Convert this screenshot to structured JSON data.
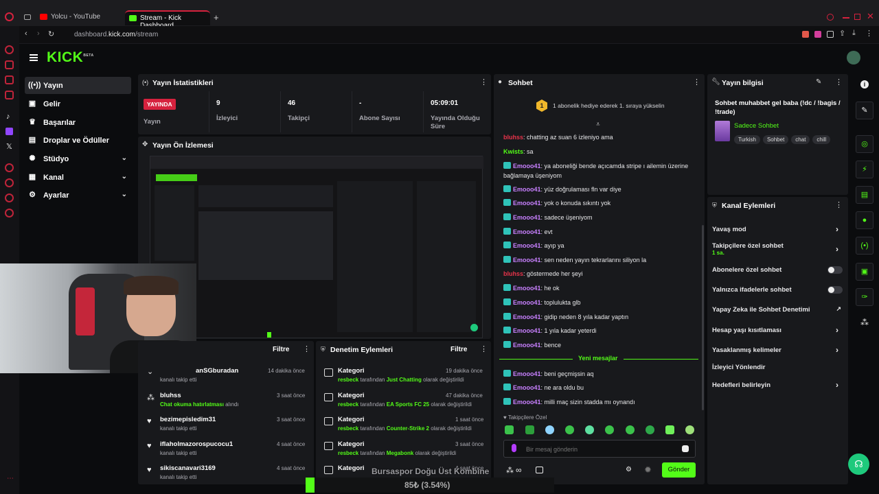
{
  "browser": {
    "tabs": [
      {
        "label": "Yolcu - YouTube"
      },
      {
        "label": "Stream - Kick Dashboard"
      }
    ],
    "new_tab": "+",
    "url_prefix": "dashboard.",
    "url_domain": "kick.com",
    "url_path": "/stream"
  },
  "nav": {
    "logo": "KICK",
    "logo_sup": "BETA",
    "items": [
      {
        "label": "Yayın",
        "icon": "broadcast-icon"
      },
      {
        "label": "Gelir",
        "icon": "wallet-icon"
      },
      {
        "label": "Başarılar",
        "icon": "trophy-icon"
      },
      {
        "label": "Droplar ve Ödüller",
        "icon": "gift-icon"
      },
      {
        "label": "Stüdyo",
        "icon": "palette-icon"
      },
      {
        "label": "Kanal",
        "icon": "channel-icon"
      },
      {
        "label": "Ayarlar",
        "icon": "gear-icon"
      }
    ]
  },
  "stats": {
    "title": "Yayın İstatistikleri",
    "live_badge": "YAYINDA",
    "live_label": "Yayın",
    "items": [
      {
        "value": "9",
        "label": "İzleyici"
      },
      {
        "value": "46",
        "label": "Takipçi"
      },
      {
        "value": "-",
        "label": "Abone Sayısı"
      },
      {
        "value": "05:09:01",
        "label": "Yayında Olduğu Süre"
      }
    ]
  },
  "preview": {
    "title": "Yayın Ön İzlemesi"
  },
  "events": {
    "filter": "Filtre",
    "rows": [
      {
        "user": "anSGburadan",
        "sub": "kanalı takip etti",
        "time": "14 dakika önce"
      },
      {
        "user": "bluhss",
        "sub_hl": "Chat okuma hatırlatması",
        "sub": " alındı",
        "time": "3 saat önce"
      },
      {
        "user": "bezimepisledim31",
        "sub": "kanalı takip etti",
        "time": "3 saat önce"
      },
      {
        "user": "iflaholmazorospucocu1",
        "sub": "kanalı takip etti",
        "time": "4 saat önce"
      },
      {
        "user": "sikiscanavari3169",
        "sub": "kanalı takip etti",
        "time": "4 saat önce"
      }
    ]
  },
  "audit": {
    "title": "Denetim Eylemleri",
    "filter": "Filtre",
    "rows": [
      {
        "title": "Kategori",
        "user": "resbeck",
        "mid": " tarafından ",
        "cat": "Just Chatting",
        "end": " olarak değiştirildi",
        "time": "19 dakika önce"
      },
      {
        "title": "Kategori",
        "user": "resbeck",
        "mid": " tarafından ",
        "cat": "EA Sports FC 25",
        "end": " olarak değiştirildi",
        "time": "47 dakika önce"
      },
      {
        "title": "Kategori",
        "user": "resbeck",
        "mid": " tarafından ",
        "cat": "Counter-Strike 2",
        "end": " olarak değiştirildi",
        "time": "1 saat önce"
      },
      {
        "title": "Kategori",
        "user": "resbeck",
        "mid": " tarafından ",
        "cat": "Megabonk",
        "end": " olarak değiştirildi",
        "time": "3 saat önce"
      },
      {
        "title": "Kategori",
        "time": "4 saat önce"
      }
    ]
  },
  "chat": {
    "title": "Sohbet",
    "gift_count": "1",
    "gift_text": "1 abonelik hediye ederek 1. sıraya yükselin",
    "messages": [
      {
        "user": "bluhss",
        "color": "#e8334a",
        "text": ": chatting az suan 6 izleniyo ama",
        "badge": false
      },
      {
        "user": "Kwists",
        "color": "#53fc18",
        "text": ": sa",
        "badge": false
      },
      {
        "user": "Emooo41",
        "color": "#c880ff",
        "text": ": ya aboneliği bende açıcamda stripe ı ailemin üzerine bağlamaya üşeniyom",
        "badge": true
      },
      {
        "user": "Emooo41",
        "color": "#c880ff",
        "text": ": yüz doğrulaması fln var diye",
        "badge": true
      },
      {
        "user": "Emooo41",
        "color": "#c880ff",
        "text": ": yok o konuda sıkıntı yok",
        "badge": true
      },
      {
        "user": "Emooo41",
        "color": "#c880ff",
        "text": ": sadece üşeniyom",
        "badge": true
      },
      {
        "user": "Emooo41",
        "color": "#c880ff",
        "text": ": evt",
        "badge": true
      },
      {
        "user": "Emooo41",
        "color": "#c880ff",
        "text": ": ayıp ya",
        "badge": true
      },
      {
        "user": "Emooo41",
        "color": "#c880ff",
        "text": ": sen neden yayın tekrarlarını siliyon la",
        "badge": true
      },
      {
        "user": "bluhss",
        "color": "#e8334a",
        "text": ": göstermede her şeyi",
        "badge": false
      },
      {
        "user": "Emooo41",
        "color": "#c880ff",
        "text": ": he ok",
        "badge": true
      },
      {
        "user": "Emooo41",
        "color": "#c880ff",
        "text": ": toplulukta glb",
        "badge": true
      },
      {
        "user": "Emooo41",
        "color": "#c880ff",
        "text": ": gidip neden 8 yıla kadar yaptın",
        "badge": true
      },
      {
        "user": "Emooo41",
        "color": "#c880ff",
        "text": ": 1 yıla kadar yeterdi",
        "badge": true
      },
      {
        "user": "Emooo41",
        "color": "#c880ff",
        "text": ": bence",
        "badge": true
      }
    ],
    "new_messages": "Yeni mesajlar",
    "new": [
      {
        "user": "Emooo41",
        "color": "#c880ff",
        "text": ": beni geçmişsin aq"
      },
      {
        "user": "Emooo41",
        "color": "#c880ff",
        "text": ": ne ara oldu bu"
      },
      {
        "user": "Emooo41",
        "color": "#c880ff",
        "text": ": milli maç sizin stadda mı oynandı"
      }
    ],
    "follower_only": "Takipçilere Özel",
    "input_placeholder": "Bir mesaj gönderin",
    "send": "Gönder"
  },
  "streaminfo": {
    "title": "Yayın bilgisi",
    "stream_title": "Sohbet muhabbet gel baba (!dc / !bagis / !trade)",
    "category": "Sadece Sohbet",
    "tags": [
      "Turkish",
      "Sohbet",
      "chat",
      "chill"
    ]
  },
  "actions": {
    "title": "Kanal Eylemleri",
    "items": [
      {
        "label": "Yavaş mod",
        "control": "arrow"
      },
      {
        "label": "Takipçilere özel sohbet",
        "sub": "1 sa.",
        "control": "arrow"
      },
      {
        "label": "Abonelere özel sohbet",
        "control": "toggle"
      },
      {
        "label": "Yalnızca ifadelerle sohbet",
        "control": "toggle"
      },
      {
        "label": "Yapay Zeka ile Sohbet Denetimi",
        "control": "external"
      },
      {
        "label": "Hesap yaşı kısıtlaması",
        "control": "arrow"
      },
      {
        "label": "Yasaklanmış kelimeler",
        "control": "arrow"
      },
      {
        "label": "İzleyici Yönlendir",
        "control": "none"
      },
      {
        "label": "Hedefleri belirleyin",
        "control": "arrow"
      }
    ]
  },
  "overlay": {
    "title": "Bursaspor Doğu Üst Kombine",
    "progress_text": "85₺ (3.54%)",
    "progress": 0.0354
  },
  "colors": {
    "accent": "#53fc18",
    "live": "#d6223e",
    "panel": "#18191c"
  }
}
